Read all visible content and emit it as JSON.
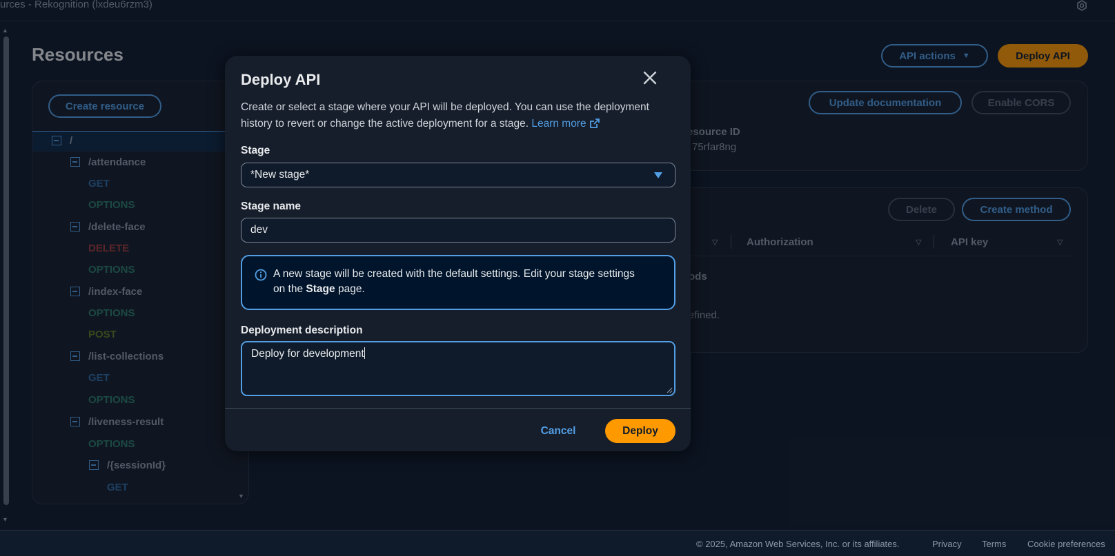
{
  "topbar": {
    "breadcrumb": "urces - Rekognition (lxdeu6rzm3)"
  },
  "page": {
    "title": "Resources",
    "api_actions_label": "API actions",
    "deploy_api_label": "Deploy API",
    "create_resource_label": "Create resource",
    "update_documentation_label": "Update documentation",
    "enable_cors_label": "Enable CORS",
    "resource_id_label": "esource ID",
    "resource_id_value": "75rfar8ng",
    "delete_label": "Delete",
    "create_method_label": "Create method",
    "columns": {
      "authorization": "Authorization",
      "api_key": "API key"
    },
    "methods_text": "ods",
    "defined_text": "efined."
  },
  "tree": {
    "root": "/",
    "attendance": "/attendance",
    "attendance_get": "GET",
    "attendance_options": "OPTIONS",
    "delete_face": "/delete-face",
    "delete_face_delete": "DELETE",
    "delete_face_options": "OPTIONS",
    "index_face": "/index-face",
    "index_face_options": "OPTIONS",
    "index_face_post": "POST",
    "list_collections": "/list-collections",
    "list_collections_get": "GET",
    "list_collections_options": "OPTIONS",
    "liveness_result": "/liveness-result",
    "liveness_result_options": "OPTIONS",
    "session_id": "/{sessionId}",
    "session_id_get": "GET"
  },
  "modal": {
    "title": "Deploy API",
    "description": "Create or select a stage where your API will be deployed. You can use the deployment history to revert or change the active deployment for a stage.",
    "learn_more": "Learn more",
    "stage_label": "Stage",
    "stage_value": "*New stage*",
    "stage_name_label": "Stage name",
    "stage_name_value": "dev",
    "info_text_before": "A new stage will be created with the default settings. Edit your stage settings on the",
    "info_text_bold": "Stage",
    "info_text_after": "page.",
    "deployment_description_label": "Deployment description",
    "deployment_description_value": "Deploy for development",
    "cancel_label": "Cancel",
    "deploy_label": "Deploy"
  },
  "footer": {
    "copyright": "© 2025, Amazon Web Services, Inc. or its affiliates.",
    "privacy": "Privacy",
    "terms": "Terms",
    "cookie_preferences": "Cookie preferences"
  },
  "colors": {
    "accent": "#539fe5",
    "primary": "#ff9900",
    "background": "#0f1b2a",
    "surface": "#161e2b"
  }
}
